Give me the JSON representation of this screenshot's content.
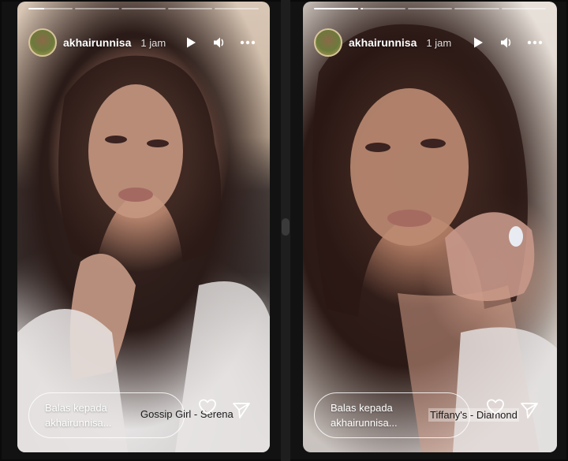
{
  "stories": [
    {
      "username": "akhairunnisa",
      "time": "1 jam",
      "progress": [
        1,
        0,
        0,
        0,
        0
      ],
      "progress_first_fill": 0.35,
      "reply_line1": "Balas kepada",
      "reply_line2": "akhairunnisa...",
      "music": "Gossip Girl - Serena"
    },
    {
      "username": "akhairunnisa",
      "time": "1 jam",
      "progress": [
        1,
        0.05,
        0,
        0,
        0
      ],
      "reply_line1": "Balas kepada",
      "reply_line2": "akhairunnisa...",
      "music": "Tiffany's - Diamond"
    }
  ],
  "icons": {
    "play": "play-icon",
    "volume": "volume-icon",
    "more": "more-icon",
    "like": "heart-icon",
    "share": "send-icon"
  }
}
